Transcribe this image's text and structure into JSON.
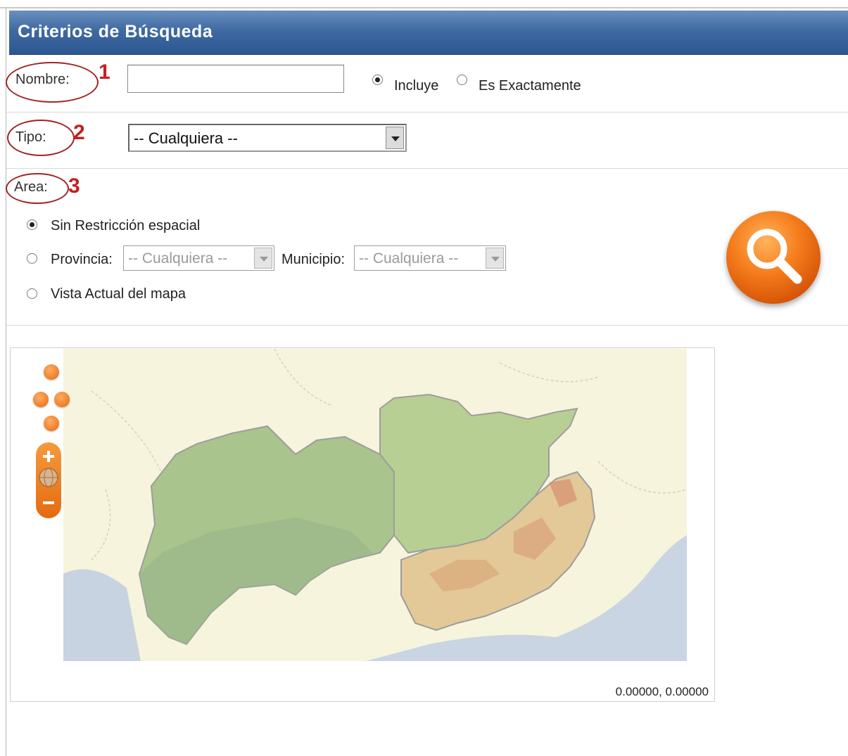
{
  "header": {
    "title": "Criterios de Búsqueda"
  },
  "nombre": {
    "label": "Nombre:",
    "marker": "1",
    "value": "",
    "options": [
      "Incluye",
      "Es Exactamente"
    ],
    "selected": "Incluye"
  },
  "tipo": {
    "label": "Tipo:",
    "marker": "2",
    "selected": "-- Cualquiera --"
  },
  "area": {
    "label": "Area:",
    "marker": "3",
    "options": {
      "sin_restriccion": "Sin Restricción espacial",
      "provincia": "Provincia:",
      "vista_actual": "Vista Actual del mapa"
    },
    "selected": "Sin Restricción espacial",
    "provincia_value": "-- Cualquiera --",
    "municipio_label": "Municipio:",
    "municipio_value": "-- Cualquiera --"
  },
  "search_button": {
    "icon": "magnifier-icon",
    "color": "#f57d1c"
  },
  "map": {
    "coordinates": "0.00000, 0.00000",
    "controls": [
      "pan-up-icon",
      "pan-left-icon",
      "pan-right-icon",
      "pan-down-icon",
      "zoom-in-icon",
      "globe-icon",
      "zoom-out-icon"
    ]
  },
  "colors": {
    "header": "#3f6aa2",
    "annotation": "#c42020",
    "accent": "#f57d1c"
  }
}
